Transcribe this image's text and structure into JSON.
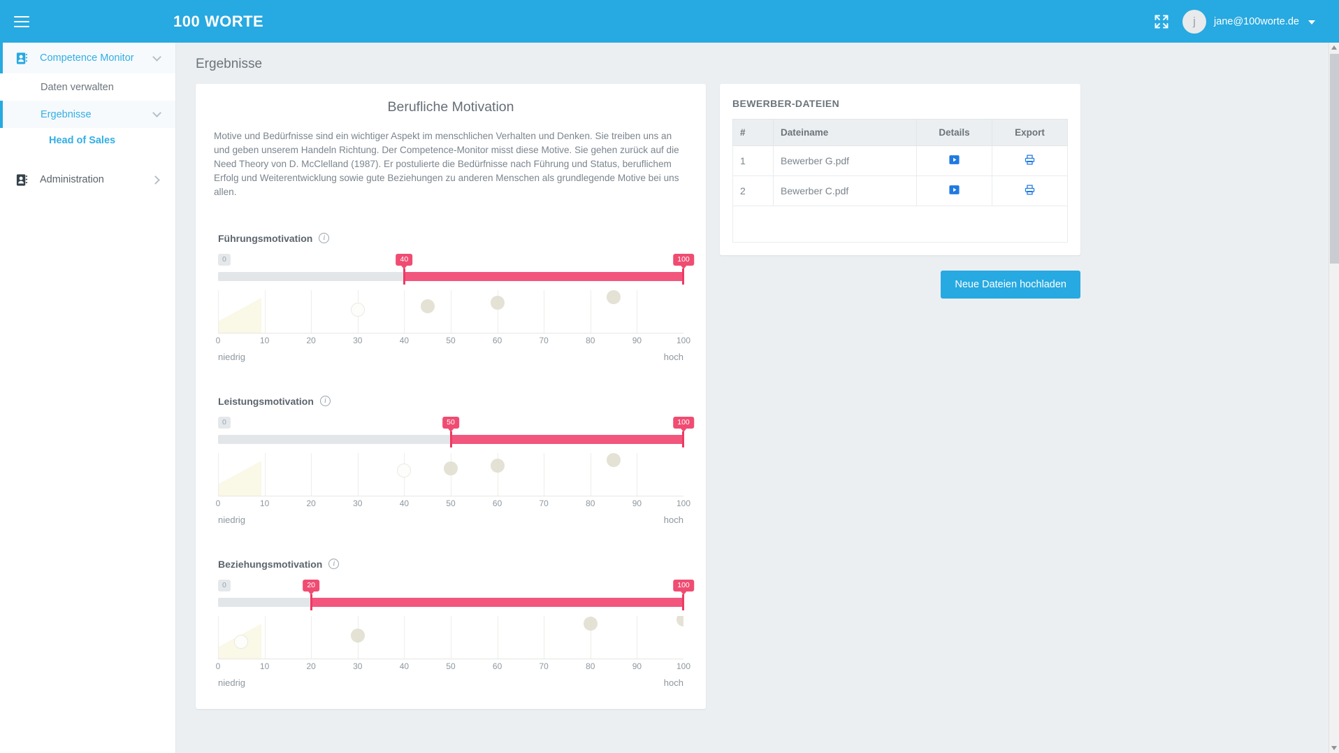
{
  "header": {
    "brand": "100 WORTE",
    "menu_icon": "hamburger-icon",
    "fullscreen_icon": "expand-icon",
    "avatar_initial": "j",
    "user_email": "jane@100worte.de"
  },
  "sidebar": {
    "items": [
      {
        "label": "Competence Monitor",
        "icon": "address-book-icon",
        "level": 1,
        "active": true,
        "chevron": "down"
      },
      {
        "label": "Daten verwalten",
        "level": 2,
        "active": false
      },
      {
        "label": "Ergebnisse",
        "level": 2,
        "active": true,
        "chevron": "down"
      },
      {
        "label": "Head of Sales",
        "level": 3,
        "active": false
      },
      {
        "label": "Administration",
        "icon": "address-book-icon",
        "level": 1,
        "active": false,
        "chevron": "right"
      }
    ]
  },
  "page": {
    "title": "Ergebnisse"
  },
  "main": {
    "title": "Berufliche Motivation",
    "description": "Motive und Bedürfnisse sind ein wichtiger Aspekt im menschlichen Verhalten und Denken. Sie treiben uns an und geben unserem Handeln Richtung. Der Competence-Monitor misst diese Motive. Sie gehen zurück auf die Need Theory von D. McClelland (1987). Er postulierte die Bedürfnisse nach Führung und Status, beruflichem Erfolg und Weiterentwicklung sowie gute Beziehungen zu anderen Menschen als grundlegende Motive bei uns allen."
  },
  "chart_data": [
    {
      "type": "scatter",
      "title": "Führungsmotivation",
      "info_icon": "info-icon",
      "slider": {
        "min": 0,
        "value": 40,
        "max": 100,
        "min_label": "0",
        "value_label": "40",
        "max_label": "100"
      },
      "x": [
        30,
        45,
        60,
        85
      ],
      "point_styles": [
        "hollow",
        "filled",
        "filled",
        "filled"
      ],
      "xlabel": "",
      "ylabel": "",
      "xlim": [
        0,
        100
      ],
      "ticks": [
        0,
        10,
        20,
        30,
        40,
        50,
        60,
        70,
        80,
        90,
        100
      ],
      "tick_labels": [
        "0",
        "10",
        "20",
        "30",
        "40",
        "50",
        "60",
        "70",
        "80",
        "90",
        "100"
      ],
      "endpoint_low": "niedrig",
      "endpoint_high": "hoch",
      "grid": true,
      "legend": "none"
    },
    {
      "type": "scatter",
      "title": "Leistungsmotivation",
      "info_icon": "info-icon",
      "slider": {
        "min": 0,
        "value": 50,
        "max": 100,
        "min_label": "0",
        "value_label": "50",
        "max_label": "100"
      },
      "x": [
        40,
        50,
        60,
        85
      ],
      "point_styles": [
        "hollow",
        "filled",
        "filled",
        "filled"
      ],
      "xlabel": "",
      "ylabel": "",
      "xlim": [
        0,
        100
      ],
      "ticks": [
        0,
        10,
        20,
        30,
        40,
        50,
        60,
        70,
        80,
        90,
        100
      ],
      "tick_labels": [
        "0",
        "10",
        "20",
        "30",
        "40",
        "50",
        "60",
        "70",
        "80",
        "90",
        "100"
      ],
      "endpoint_low": "niedrig",
      "endpoint_high": "hoch",
      "grid": true,
      "legend": "none"
    },
    {
      "type": "scatter",
      "title": "Beziehungsmotivation",
      "info_icon": "info-icon",
      "slider": {
        "min": 0,
        "value": 20,
        "max": 100,
        "min_label": "0",
        "value_label": "20",
        "max_label": "100"
      },
      "x": [
        5,
        30,
        80,
        100
      ],
      "point_styles": [
        "hollow",
        "filled",
        "filled",
        "filled"
      ],
      "xlabel": "",
      "ylabel": "",
      "xlim": [
        0,
        100
      ],
      "ticks": [
        0,
        10,
        20,
        30,
        40,
        50,
        60,
        70,
        80,
        90,
        100
      ],
      "tick_labels": [
        "0",
        "10",
        "20",
        "30",
        "40",
        "50",
        "60",
        "70",
        "80",
        "90",
        "100"
      ],
      "endpoint_low": "niedrig",
      "endpoint_high": "hoch",
      "grid": true,
      "legend": "none"
    }
  ],
  "files_panel": {
    "title": "BEWERBER-DATEIEN",
    "columns": [
      "#",
      "Dateiname",
      "Details",
      "Export"
    ],
    "rows": [
      {
        "num": "1",
        "filename": "Bewerber G.pdf",
        "details_icon": "play-box-icon",
        "export_icon": "printer-icon"
      },
      {
        "num": "2",
        "filename": "Bewerber C.pdf",
        "details_icon": "play-box-icon",
        "export_icon": "printer-icon"
      }
    ],
    "upload_button": "Neue Dateien hochladen"
  },
  "colors": {
    "brand_blue": "#27a9e1",
    "slider_pink": "#f2567d",
    "badge_pink": "#f04c72",
    "plot_yellow": "#faf8e6"
  }
}
